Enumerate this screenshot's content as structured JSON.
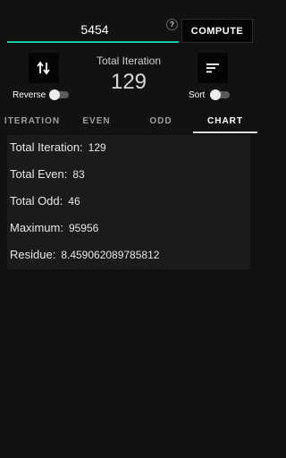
{
  "input": {
    "value": "5454"
  },
  "help": {
    "glyph": "?"
  },
  "compute": {
    "label": "COMPUTE"
  },
  "total": {
    "label": "Total Iteration",
    "value": "129"
  },
  "reverse": {
    "label": "Reverse",
    "on": false
  },
  "sort": {
    "label": "Sort",
    "on": false
  },
  "tabs": [
    {
      "label": "ITERATION",
      "active": false
    },
    {
      "label": "EVEN",
      "active": false
    },
    {
      "label": "ODD",
      "active": false
    },
    {
      "label": "CHART",
      "active": true
    }
  ],
  "stats": [
    {
      "label": "Total Iteration:",
      "value": "129"
    },
    {
      "label": "Total Even:",
      "value": "83"
    },
    {
      "label": "Total Odd:",
      "value": "46"
    },
    {
      "label": "Maximum:",
      "value": "95956"
    },
    {
      "label": "Residue:",
      "value": "8.459062089785812"
    }
  ],
  "colors": {
    "accent": "#19c9a2",
    "background": "#121212",
    "panel": "#1b1b1b"
  },
  "icons": {
    "reverse": "swap-vertical-icon",
    "sort": "sort-icon"
  }
}
